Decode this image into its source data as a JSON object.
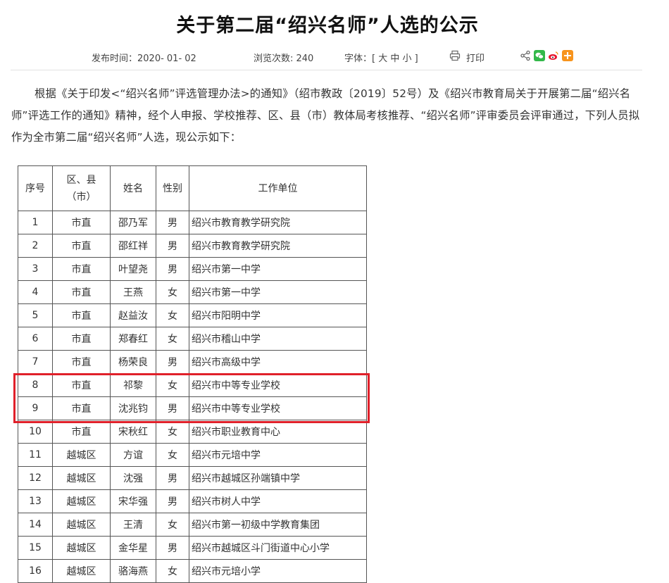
{
  "article": {
    "title": "关于第二届“绍兴名师”人选的公示",
    "published": "发布时间：2020- 01- 02",
    "views": "浏览次数: 240",
    "fontsize": "字体：[ 大 中 小 ]",
    "print": "打印",
    "body": "根据《关于印发<“绍兴名师”评选管理办法>的通知》（绍市教政〔2019〕52号）及《绍兴市教育局关于开展第二届“绍兴名师”评选工作的通知》精神，经个人申报、学校推荐、区、县（市）教体局考核推荐、“绍兴名师”评审委员会评审通过，下列人员拟作为全市第二届“绍兴名师”人选，现公示如下："
  },
  "icons": {
    "share": "share-icon",
    "wechat": "wechat-icon",
    "weibo": "weibo-icon",
    "more": "more-share-icon",
    "print": "printer-icon"
  },
  "colors": {
    "highlight": "#e0202a",
    "wechat": "#33b84a",
    "weibo": "#e6162d",
    "more": "#f7941d"
  },
  "table": {
    "headers": [
      "序号",
      "区、县\n（市）",
      "姓名",
      "性别",
      "工作单位"
    ],
    "rows": [
      [
        "1",
        "市直",
        "邵乃军",
        "男",
        "绍兴市教育教学研究院"
      ],
      [
        "2",
        "市直",
        "邵红祥",
        "男",
        "绍兴市教育教学研究院"
      ],
      [
        "3",
        "市直",
        "叶望尧",
        "男",
        "绍兴市第一中学"
      ],
      [
        "4",
        "市直",
        "王燕",
        "女",
        "绍兴市第一中学"
      ],
      [
        "5",
        "市直",
        "赵益汝",
        "女",
        "绍兴市阳明中学"
      ],
      [
        "6",
        "市直",
        "郑春红",
        "女",
        "绍兴市稽山中学"
      ],
      [
        "7",
        "市直",
        "杨荣良",
        "男",
        "绍兴市高级中学"
      ],
      [
        "8",
        "市直",
        "祁黎",
        "女",
        "绍兴市中等专业学校"
      ],
      [
        "9",
        "市直",
        "沈兆钧",
        "男",
        "绍兴市中等专业学校"
      ],
      [
        "10",
        "市直",
        "宋秋红",
        "女",
        "绍兴市职业教育中心"
      ],
      [
        "11",
        "越城区",
        "方谊",
        "女",
        "绍兴市元培中学"
      ],
      [
        "12",
        "越城区",
        "沈强",
        "男",
        "绍兴市越城区孙端镇中学"
      ],
      [
        "13",
        "越城区",
        "宋华强",
        "男",
        "绍兴市树人中学"
      ],
      [
        "14",
        "越城区",
        "王清",
        "女",
        "绍兴市第一初级中学教育集团"
      ],
      [
        "15",
        "越城区",
        "金华星",
        "男",
        "绍兴市越城区斗门街道中心小学"
      ],
      [
        "16",
        "越城区",
        "骆海燕",
        "女",
        "绍兴市元培小学"
      ]
    ]
  }
}
